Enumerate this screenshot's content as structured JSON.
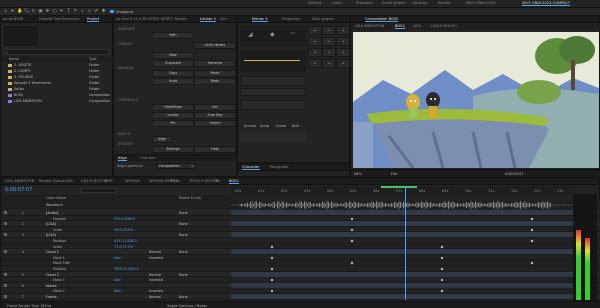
{
  "app": {
    "workspaces": [
      "Default",
      "Learn",
      "Standard",
      "Small Screen",
      "Libraries",
      "Review",
      "SELF-ONLY-2023",
      "SELF-ONLY-2023-COMPACT"
    ],
    "active_workspace": "SELF-ONLY-2023-COMPACT",
    "snapping_label": "Snapping"
  },
  "left_panel": {
    "tabs": [
      "pcuts 6158",
      "Dashlet Tool Extension",
      "Project"
    ],
    "active_tab": "Project",
    "search_placeholder": "",
    "columns": [
      "Name",
      "Type"
    ],
    "items": [
      {
        "name": "1. ASSETS",
        "type": "Folder",
        "kind": "folder"
      },
      {
        "name": "2. COMPS",
        "type": "Folder",
        "kind": "folder"
      },
      {
        "name": "3. SOUNDS",
        "type": "Folder",
        "kind": "folder"
      },
      {
        "name": "Episode 2 Wireframes",
        "type": "Folder",
        "kind": "folder"
      },
      {
        "name": "Solids",
        "type": "Folder",
        "kind": "folder"
      },
      {
        "name": "BG02",
        "type": "Composition",
        "kind": "comp"
      },
      {
        "name": "LISA ANIMATION",
        "type": "Composition",
        "kind": "comp"
      }
    ]
  },
  "limber_panel": {
    "tabs": [
      "Ae Dev K 11.0 BY INTRO HEXET",
      "Tracker",
      "Limber 2",
      "Sim"
    ],
    "active_tab": "Limber 2",
    "sections": [
      "INDICATE",
      "CREATE",
      "MANAGE",
      "CONTROLS",
      "MATCH",
      "SYSTEM"
    ],
    "buttons": [
      "Path",
      "Limb Library",
      "New",
      "Duplicate",
      "Rename",
      "Copy",
      "Paste",
      "Undo",
      "Redo",
      "Hide/Show",
      "Locate",
      "Pin",
      "Auto Bay",
      "Select",
      "Align",
      "Set",
      "Settings",
      "Help"
    ],
    "bottom_tabs": [
      "Align",
      "Overlord"
    ],
    "align_layers_to_label": "Align Layers to:",
    "align_layers_to_value": "Composition"
  },
  "motion_panel": {
    "tabs": [
      "Motion 4",
      "Properties",
      "Duik Angela"
    ],
    "active_tab": "Motion 4",
    "labels": [
      "Anchor",
      "Jump",
      "Clone",
      "Null"
    ]
  },
  "character_panel": {
    "tabs": [
      "Character",
      "Paragraph"
    ],
    "active_tab": "Character"
  },
  "viewer": {
    "tab_title": "Composition BG02",
    "breadcrumbs": [
      "LISA ANIMATION",
      "BG02",
      "LISA",
      "LISA'S MOUTH"
    ],
    "active_breadcrumb": "BG02",
    "zoom": "50%",
    "resolution": "Full",
    "timecode": "0:00:07:07",
    "colors": {
      "sky": "#e7ead9",
      "mountain": "#6f8ec7",
      "grass": "#9dbb3a",
      "cliff": "#7d8fb0",
      "tree": "#4d7a37"
    }
  },
  "timeline": {
    "tabs": [
      "LISA ANIMATION",
      "Render Queue",
      "LISA",
      "LISA'S MOUTH",
      "BOB",
      "WOMAN",
      "WOMAN MOUTH",
      "TROLL",
      "TROLL'S MOUTH",
      "BG",
      "BG02"
    ],
    "active_tab": "BG02",
    "timecode": "0:00:07:07",
    "columns": [
      "Layer Name",
      "Parent & Link"
    ],
    "waveform_label": "Waveform",
    "ruler": [
      "00s",
      "01s",
      "02s",
      "03s",
      "04s",
      "05s",
      "06s",
      "07s",
      "08s",
      "09s",
      "10s",
      "11s",
      "12s",
      "13s",
      "14s"
    ],
    "layers": [
      {
        "num": "1",
        "name": "[Audio]",
        "value": "",
        "mode": "",
        "parent": "None"
      },
      {
        "num": "",
        "name": "Position",
        "value": "923.0,998.8",
        "mode": "",
        "parent": ""
      },
      {
        "num": "2",
        "name": "[LISA]",
        "value": "",
        "mode": "",
        "parent": "None"
      },
      {
        "num": "",
        "name": "Scale",
        "value": "70.0,70.0%",
        "mode": "",
        "parent": ""
      },
      {
        "num": "3",
        "name": "[LISA]",
        "value": "",
        "mode": "",
        "parent": "None"
      },
      {
        "num": "",
        "name": "Position",
        "value": "915.0,1058.0",
        "mode": "",
        "parent": ""
      },
      {
        "num": "",
        "name": "Scale",
        "value": "71.0,71.0%",
        "mode": "",
        "parent": ""
      },
      {
        "num": "4",
        "name": "Cloud 1",
        "value": "",
        "mode": "Normal",
        "parent": "None"
      },
      {
        "num": "",
        "name": "Mask 1",
        "value": "Add",
        "mode": "Inverted",
        "parent": ""
      },
      {
        "num": "",
        "name": "Mask Path",
        "value": "",
        "mode": "",
        "parent": ""
      },
      {
        "num": "",
        "name": "Position",
        "value": "1900.0,1025.0",
        "mode": "",
        "parent": ""
      },
      {
        "num": "5",
        "name": "Cloud 2",
        "value": "",
        "mode": "Normal",
        "parent": "None"
      },
      {
        "num": "",
        "name": "Mask 1",
        "value": "Add",
        "mode": "Inverted",
        "parent": ""
      },
      {
        "num": "6",
        "name": "Masks",
        "value": "",
        "mode": "",
        "parent": ""
      },
      {
        "num": "",
        "name": "Mask 1",
        "value": "Add",
        "mode": "Inverted",
        "parent": ""
      },
      {
        "num": "7",
        "name": "Frame",
        "value": "",
        "mode": "Normal",
        "parent": "None"
      }
    ],
    "footer": "Frame Render Time 187ms",
    "toggle_label": "Toggle Switches / Modes"
  }
}
